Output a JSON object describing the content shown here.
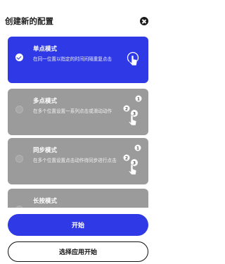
{
  "header": {
    "title": "创建新的配置",
    "close_icon": "close-icon"
  },
  "modes": [
    {
      "name": "单点模式",
      "description": "在同一位置以指定的时间间隔重复点击",
      "selected": true,
      "icon": "single-tap-icon"
    },
    {
      "name": "多点模式",
      "description": "在多个位置设置一系列点击或滑动动作",
      "selected": false,
      "icon": "multi-tap-icon"
    },
    {
      "name": "同步模式",
      "description": "在多个位置设置点击动作待同步进行点击",
      "selected": false,
      "icon": "sync-tap-icon"
    },
    {
      "name": "长按模式",
      "description": "",
      "selected": false,
      "icon": ""
    }
  ],
  "actions": {
    "start_label": "开始",
    "choose_app_label": "选择应用开始"
  },
  "colors": {
    "accent": "#2f39e5",
    "card_inactive": "#9b9b9b"
  }
}
